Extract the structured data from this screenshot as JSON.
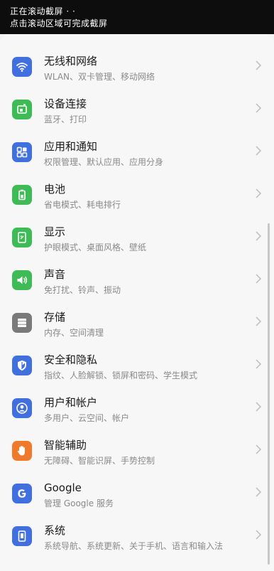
{
  "banner": {
    "line1": "正在滚动截屏 · ·",
    "line2": "点击滚动区域可完成截屏"
  },
  "settings": {
    "items": [
      {
        "title": "无线和网络",
        "subtitle": "WLAN、双卡管理、移动网络",
        "icon": "wifi-icon",
        "color": "#3f6fe0"
      },
      {
        "title": "设备连接",
        "subtitle": "蓝牙、打印",
        "icon": "device-connection-icon",
        "color": "#3dbb55"
      },
      {
        "title": "应用和通知",
        "subtitle": "权限管理、默认应用、应用分身",
        "icon": "apps-grid-icon",
        "color": "#3f6fe0"
      },
      {
        "title": "电池",
        "subtitle": "省电模式、耗电排行",
        "icon": "battery-icon",
        "color": "#3dbb55"
      },
      {
        "title": "显示",
        "subtitle": "护眼模式、桌面风格、壁纸",
        "icon": "display-icon",
        "color": "#3dbb55"
      },
      {
        "title": "声音",
        "subtitle": "免打扰、铃声、振动",
        "icon": "sound-icon",
        "color": "#3dbb55"
      },
      {
        "title": "存储",
        "subtitle": "内存、空间清理",
        "icon": "storage-icon",
        "color": "#7a7a7a"
      },
      {
        "title": "安全和隐私",
        "subtitle": "指纹、人脸解锁、锁屏和密码、学生模式",
        "icon": "shield-icon",
        "color": "#3f6fe0"
      },
      {
        "title": "用户和帐户",
        "subtitle": "多用户、云空间、帐户",
        "icon": "user-icon",
        "color": "#3f6fe0"
      },
      {
        "title": "智能辅助",
        "subtitle": "无障碍、智能识屏、手势控制",
        "icon": "hand-icon",
        "color": "#f07a2a"
      },
      {
        "title": "Google",
        "subtitle": "管理 Google 服务",
        "icon": "google-icon",
        "color": "#3f6fe0"
      },
      {
        "title": "系统",
        "subtitle": "系统导航、系统更新、关于手机、语言和输入法",
        "icon": "system-icon",
        "color": "#3f6fe0"
      }
    ]
  },
  "icons": {
    "chevron": "chevron-right-icon"
  }
}
